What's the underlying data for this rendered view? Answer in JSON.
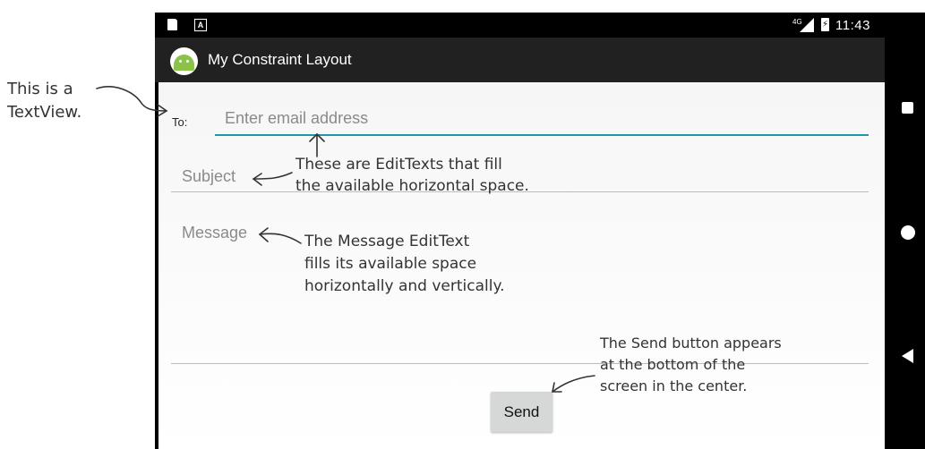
{
  "status_bar": {
    "network": "4G",
    "time": "11:43",
    "left_icons": [
      "sd-card-icon",
      "a-notification-icon"
    ],
    "right_icons": [
      "signal-icon",
      "battery-charging-icon"
    ]
  },
  "app_bar": {
    "title": "My Constraint Layout",
    "logo_icon": "android-icon"
  },
  "form": {
    "to_label": "To:",
    "email_placeholder": "Enter email address",
    "subject_placeholder": "Subject",
    "message_placeholder": "Message",
    "send_label": "Send",
    "accent_color": "#2196a8"
  },
  "nav_bar": {
    "icons": [
      "recents-icon",
      "home-icon",
      "back-icon"
    ]
  },
  "annotations": {
    "textview": "This is a\nTextView.",
    "edittexts": "These are EditTexts that fill\nthe available horizontal space.",
    "message": "The Message EditText\nfills its available space\nhorizontally and vertically.",
    "send": "The Send button appears\nat the bottom of the\nscreen in the center."
  }
}
